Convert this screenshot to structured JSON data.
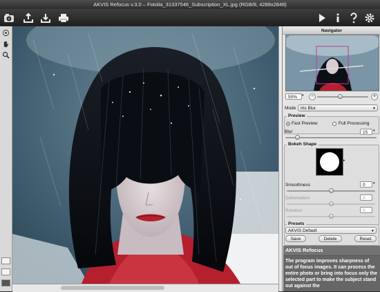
{
  "window": {
    "title": "AKVIS Refocus v.3.0 – Fotolia_31337546_Subscription_XL.jpg (RGB/8, 4288x2848)"
  },
  "toolbar": {
    "left_icons": [
      "app-logo-icon",
      "open-icon",
      "save-icon",
      "print-icon"
    ],
    "right_icons": [
      "run-icon",
      "info-icon",
      "help-icon",
      "settings-icon"
    ]
  },
  "navigator": {
    "title": "Navigator",
    "zoom_value": "50%"
  },
  "settings": {
    "mode_label": "Mode",
    "mode_value": "Iris Blur",
    "preview_title": "Preview",
    "fast_preview_label": "Fast Preview",
    "full_processing_label": "Full Processing",
    "fast_preview_selected": true,
    "blur_label": "Blur",
    "blur_value": "15",
    "bokeh_title": "Bokeh Shape",
    "smoothness_label": "Smoothness",
    "smoothness_value": "0",
    "deformation_label": "Deformation",
    "deformation_value": "0",
    "rotation_label": "Rotation",
    "rotation_value": "0"
  },
  "presets": {
    "title": "Presets",
    "selected": "AKVIS Default",
    "save_label": "Save",
    "delete_label": "Delete",
    "reset_label": "Reset"
  },
  "help": {
    "title": "AKVIS Refocus",
    "text": "The program improves sharpness of out of focus images. It can process the entire photo or bring into focus only the selected part to make the subject stand out against the"
  },
  "colors": {
    "accent": "#1d5fbf",
    "panel_bg": "#e4e4e4",
    "help_bg": "#666666"
  }
}
